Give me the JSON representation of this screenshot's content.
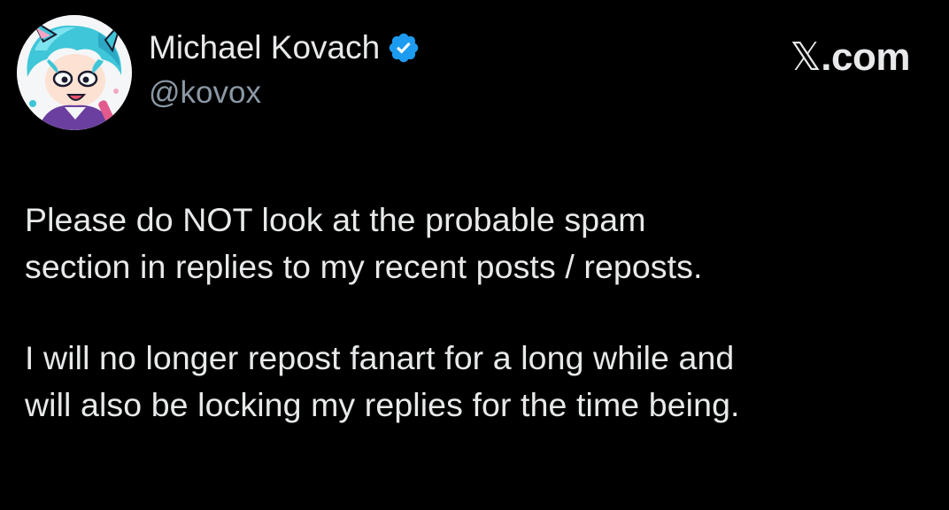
{
  "post": {
    "author": {
      "name": "Michael Kovach",
      "handle": "@kovox",
      "verified": true,
      "badge_icon": "verified-badge-icon",
      "avatar_icon": "avatar-illustration"
    },
    "site": {
      "x_glyph": "𝕏",
      "domain_suffix": ".com"
    },
    "paragraphs": [
      {
        "lines": [
          "Please do NOT look at the probable spam",
          "section in replies to my recent posts / reposts."
        ]
      },
      {
        "lines": [
          "I will no longer repost fanart for a long while and",
          "will also be locking my replies for the time being."
        ]
      }
    ]
  },
  "colors": {
    "background": "#000000",
    "text_primary": "#e7e9ea",
    "text_secondary": "#8b98a5",
    "verified_blue": "#1d9bf0"
  }
}
